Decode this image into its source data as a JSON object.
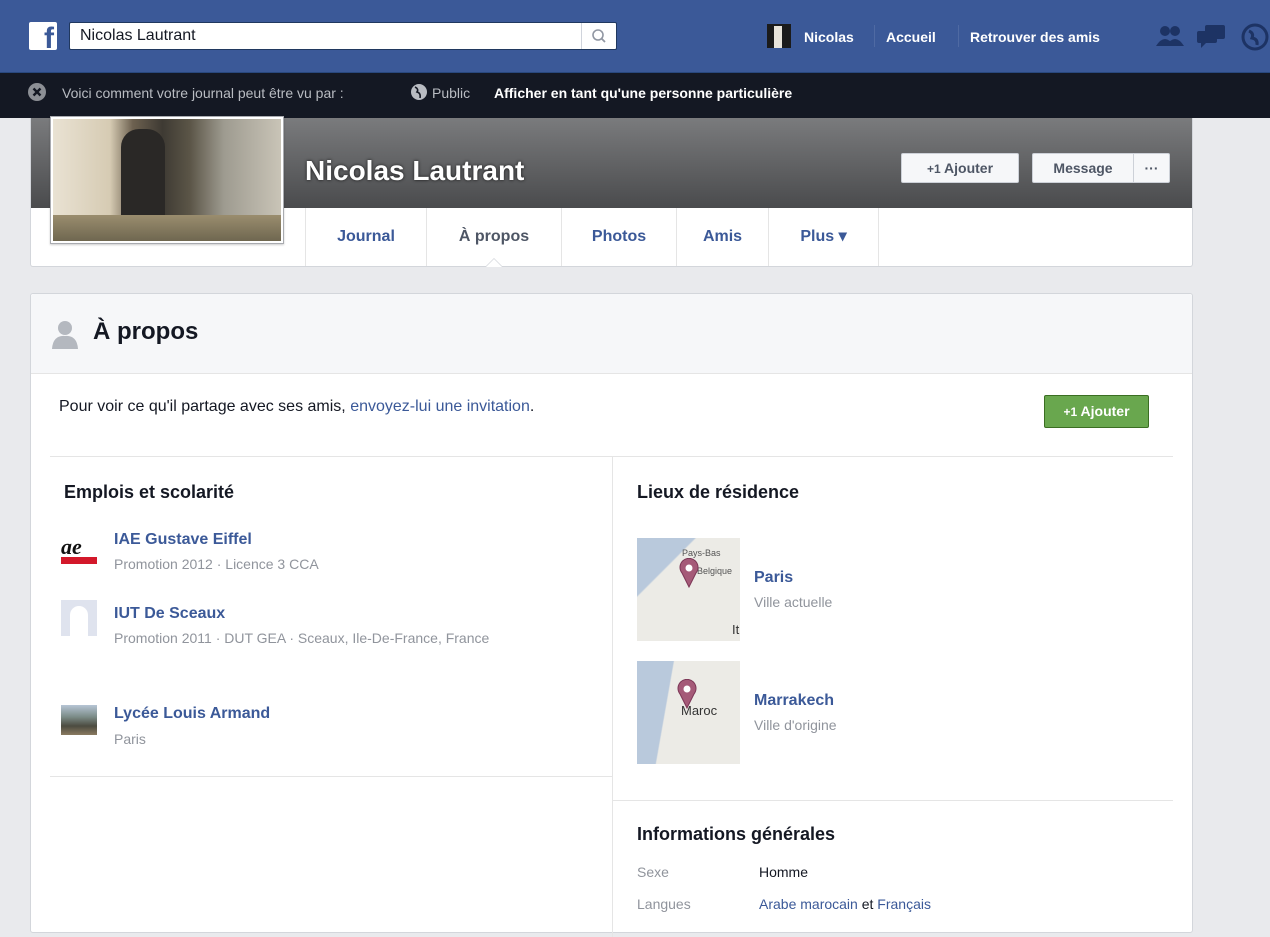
{
  "topbar": {
    "logo_letter": "f",
    "search_value": "Nicolas Lautrant",
    "user_name": "Nicolas",
    "home_label": "Accueil",
    "find_friends_label": "Retrouver des amis"
  },
  "notice": {
    "text": "Voici comment votre journal peut être vu par :",
    "audience": "Public",
    "view_as": "Afficher en tant qu'une personne particulière"
  },
  "profile": {
    "name": "Nicolas Lautrant",
    "add_friend_label": "Ajouter",
    "message_label": "Message",
    "more_label": "···",
    "tabs": [
      {
        "label": "Journal"
      },
      {
        "label": "À propos"
      },
      {
        "label": "Photos"
      },
      {
        "label": "Amis"
      },
      {
        "label": "Plus ▾"
      }
    ]
  },
  "about": {
    "title": "À propos",
    "invite_prefix": "Pour voir ce qu'il partage avec ses amis, ",
    "invite_link": "envoyez-lui une invitation",
    "invite_suffix": ".",
    "add_button": "Ajouter",
    "work": {
      "title": "Emplois et scolarité",
      "thumb_text": "ae",
      "entries": [
        {
          "name": "IAE Gustave Eiffel",
          "detail": "Promotion 2012 · Licence 3 CCA"
        },
        {
          "name": "IUT De Sceaux",
          "detail": "Promotion 2011 · DUT GEA · Sceaux, Ile-De-France, France"
        },
        {
          "name": "Lycée Louis Armand",
          "detail": "Paris"
        }
      ]
    },
    "places": {
      "title": "Lieux de résidence",
      "entries": [
        {
          "name": "Paris",
          "detail": "Ville actuelle",
          "map_labels": [
            "Pays-Bas",
            "Belgique",
            "It"
          ]
        },
        {
          "name": "Marrakech",
          "detail": "Ville d'origine",
          "map_labels": [
            "Maroc"
          ]
        }
      ]
    },
    "general": {
      "title": "Informations générales",
      "gender_label": "Sexe",
      "gender_value": "Homme",
      "languages_label": "Langues",
      "language_1": "Arabe marocain",
      "language_joiner": " et ",
      "language_2": "Français"
    }
  },
  "colors": {
    "brand_blue": "#3b5998",
    "notice_bg": "#141823",
    "green_button": "#69a74e"
  }
}
